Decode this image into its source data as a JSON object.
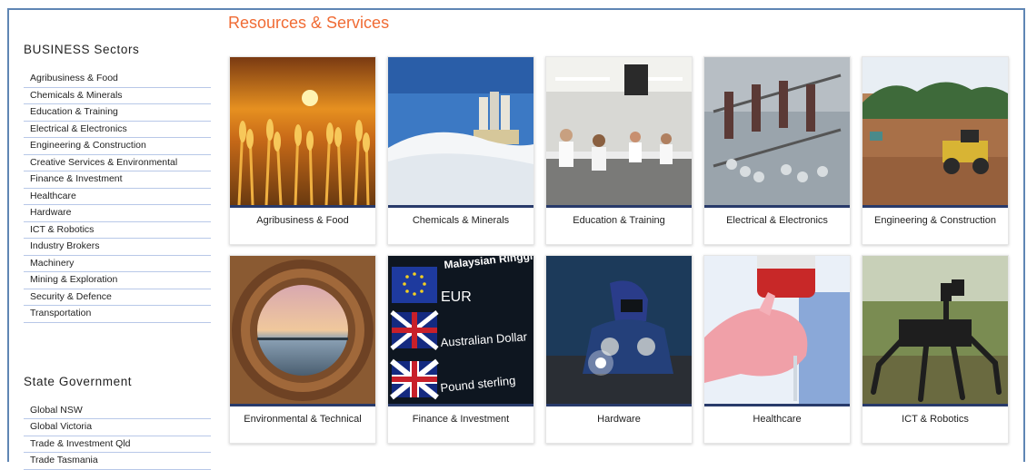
{
  "page": {
    "title": "Resources & Services"
  },
  "sidebar": {
    "business": {
      "title": "BUSINESS Sectors",
      "items": [
        "Agribusiness & Food",
        "Chemicals & Minerals",
        "Education & Training",
        "Electrical & Electronics",
        "Engineering & Construction",
        "Creative Services & Environmental",
        "Finance & Investment",
        "Healthcare",
        "Hardware",
        "ICT & Robotics",
        "Industry Brokers",
        "Machinery",
        "Mining & Exploration",
        "Security & Defence",
        "Transportation"
      ]
    },
    "state": {
      "title": "State Government",
      "items": [
        "Global NSW",
        "Global Victoria",
        "Trade & Investment Qld",
        "Trade Tasmania"
      ]
    }
  },
  "cards": [
    {
      "label": "Agribusiness & Food",
      "image": "wheat-field-sunset"
    },
    {
      "label": "Chemicals & Minerals",
      "image": "mineral-plant-silos"
    },
    {
      "label": "Education & Training",
      "image": "laboratory-classroom"
    },
    {
      "label": "Electrical & Electronics",
      "image": "power-insulators"
    },
    {
      "label": "Engineering & Construction",
      "image": "construction-earthworks"
    },
    {
      "label": "Environmental & Technical",
      "image": "pipe-view-sunset"
    },
    {
      "label": "Finance & Investment",
      "image": "currency-board",
      "board": [
        "Malaysian Ringgit",
        "EUR",
        "Australian Dollar",
        "Pound sterling"
      ]
    },
    {
      "label": "Hardware",
      "image": "welder"
    },
    {
      "label": "Healthcare",
      "image": "blood-sample-glove"
    },
    {
      "label": "ICT & Robotics",
      "image": "robot-spider"
    }
  ],
  "colors": {
    "accent": "#f06b34",
    "divider": "#283a6a",
    "frame": "#5f86b4"
  }
}
